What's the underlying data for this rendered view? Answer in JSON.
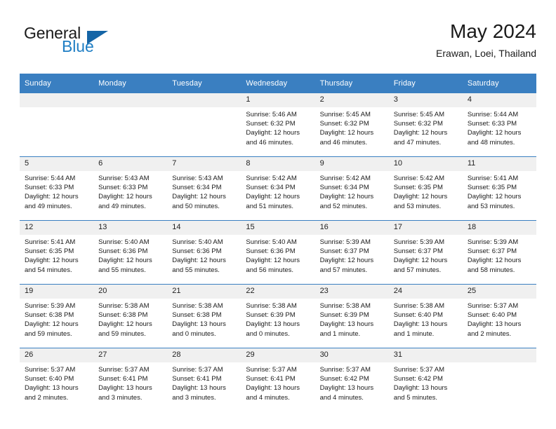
{
  "brand": {
    "name_top": "General",
    "name_bottom": "Blue",
    "triangle_icon": "brand-triangle-icon",
    "accent_color": "#1f7ec4",
    "triangle_color": "#1565a6"
  },
  "header": {
    "title": "May 2024",
    "subtitle": "Erawan, Loei, Thailand"
  },
  "calendar": {
    "header_bg_color": "#3a7fc1",
    "daynum_bg_color": "#f0f0f0",
    "weekday_headers": [
      "Sunday",
      "Monday",
      "Tuesday",
      "Wednesday",
      "Thursday",
      "Friday",
      "Saturday"
    ],
    "weeks": [
      [
        {
          "day": "",
          "empty": true,
          "sunrise": "",
          "sunset": "",
          "daylight_line1": "",
          "daylight_line2": ""
        },
        {
          "day": "",
          "empty": true,
          "sunrise": "",
          "sunset": "",
          "daylight_line1": "",
          "daylight_line2": ""
        },
        {
          "day": "",
          "empty": true,
          "sunrise": "",
          "sunset": "",
          "daylight_line1": "",
          "daylight_line2": ""
        },
        {
          "day": "1",
          "empty": false,
          "sunrise": "Sunrise: 5:46 AM",
          "sunset": "Sunset: 6:32 PM",
          "daylight_line1": "Daylight: 12 hours",
          "daylight_line2": "and 46 minutes."
        },
        {
          "day": "2",
          "empty": false,
          "sunrise": "Sunrise: 5:45 AM",
          "sunset": "Sunset: 6:32 PM",
          "daylight_line1": "Daylight: 12 hours",
          "daylight_line2": "and 46 minutes."
        },
        {
          "day": "3",
          "empty": false,
          "sunrise": "Sunrise: 5:45 AM",
          "sunset": "Sunset: 6:32 PM",
          "daylight_line1": "Daylight: 12 hours",
          "daylight_line2": "and 47 minutes."
        },
        {
          "day": "4",
          "empty": false,
          "sunrise": "Sunrise: 5:44 AM",
          "sunset": "Sunset: 6:33 PM",
          "daylight_line1": "Daylight: 12 hours",
          "daylight_line2": "and 48 minutes."
        }
      ],
      [
        {
          "day": "5",
          "empty": false,
          "sunrise": "Sunrise: 5:44 AM",
          "sunset": "Sunset: 6:33 PM",
          "daylight_line1": "Daylight: 12 hours",
          "daylight_line2": "and 49 minutes."
        },
        {
          "day": "6",
          "empty": false,
          "sunrise": "Sunrise: 5:43 AM",
          "sunset": "Sunset: 6:33 PM",
          "daylight_line1": "Daylight: 12 hours",
          "daylight_line2": "and 49 minutes."
        },
        {
          "day": "7",
          "empty": false,
          "sunrise": "Sunrise: 5:43 AM",
          "sunset": "Sunset: 6:34 PM",
          "daylight_line1": "Daylight: 12 hours",
          "daylight_line2": "and 50 minutes."
        },
        {
          "day": "8",
          "empty": false,
          "sunrise": "Sunrise: 5:42 AM",
          "sunset": "Sunset: 6:34 PM",
          "daylight_line1": "Daylight: 12 hours",
          "daylight_line2": "and 51 minutes."
        },
        {
          "day": "9",
          "empty": false,
          "sunrise": "Sunrise: 5:42 AM",
          "sunset": "Sunset: 6:34 PM",
          "daylight_line1": "Daylight: 12 hours",
          "daylight_line2": "and 52 minutes."
        },
        {
          "day": "10",
          "empty": false,
          "sunrise": "Sunrise: 5:42 AM",
          "sunset": "Sunset: 6:35 PM",
          "daylight_line1": "Daylight: 12 hours",
          "daylight_line2": "and 53 minutes."
        },
        {
          "day": "11",
          "empty": false,
          "sunrise": "Sunrise: 5:41 AM",
          "sunset": "Sunset: 6:35 PM",
          "daylight_line1": "Daylight: 12 hours",
          "daylight_line2": "and 53 minutes."
        }
      ],
      [
        {
          "day": "12",
          "empty": false,
          "sunrise": "Sunrise: 5:41 AM",
          "sunset": "Sunset: 6:35 PM",
          "daylight_line1": "Daylight: 12 hours",
          "daylight_line2": "and 54 minutes."
        },
        {
          "day": "13",
          "empty": false,
          "sunrise": "Sunrise: 5:40 AM",
          "sunset": "Sunset: 6:36 PM",
          "daylight_line1": "Daylight: 12 hours",
          "daylight_line2": "and 55 minutes."
        },
        {
          "day": "14",
          "empty": false,
          "sunrise": "Sunrise: 5:40 AM",
          "sunset": "Sunset: 6:36 PM",
          "daylight_line1": "Daylight: 12 hours",
          "daylight_line2": "and 55 minutes."
        },
        {
          "day": "15",
          "empty": false,
          "sunrise": "Sunrise: 5:40 AM",
          "sunset": "Sunset: 6:36 PM",
          "daylight_line1": "Daylight: 12 hours",
          "daylight_line2": "and 56 minutes."
        },
        {
          "day": "16",
          "empty": false,
          "sunrise": "Sunrise: 5:39 AM",
          "sunset": "Sunset: 6:37 PM",
          "daylight_line1": "Daylight: 12 hours",
          "daylight_line2": "and 57 minutes."
        },
        {
          "day": "17",
          "empty": false,
          "sunrise": "Sunrise: 5:39 AM",
          "sunset": "Sunset: 6:37 PM",
          "daylight_line1": "Daylight: 12 hours",
          "daylight_line2": "and 57 minutes."
        },
        {
          "day": "18",
          "empty": false,
          "sunrise": "Sunrise: 5:39 AM",
          "sunset": "Sunset: 6:37 PM",
          "daylight_line1": "Daylight: 12 hours",
          "daylight_line2": "and 58 minutes."
        }
      ],
      [
        {
          "day": "19",
          "empty": false,
          "sunrise": "Sunrise: 5:39 AM",
          "sunset": "Sunset: 6:38 PM",
          "daylight_line1": "Daylight: 12 hours",
          "daylight_line2": "and 59 minutes."
        },
        {
          "day": "20",
          "empty": false,
          "sunrise": "Sunrise: 5:38 AM",
          "sunset": "Sunset: 6:38 PM",
          "daylight_line1": "Daylight: 12 hours",
          "daylight_line2": "and 59 minutes."
        },
        {
          "day": "21",
          "empty": false,
          "sunrise": "Sunrise: 5:38 AM",
          "sunset": "Sunset: 6:38 PM",
          "daylight_line1": "Daylight: 13 hours",
          "daylight_line2": "and 0 minutes."
        },
        {
          "day": "22",
          "empty": false,
          "sunrise": "Sunrise: 5:38 AM",
          "sunset": "Sunset: 6:39 PM",
          "daylight_line1": "Daylight: 13 hours",
          "daylight_line2": "and 0 minutes."
        },
        {
          "day": "23",
          "empty": false,
          "sunrise": "Sunrise: 5:38 AM",
          "sunset": "Sunset: 6:39 PM",
          "daylight_line1": "Daylight: 13 hours",
          "daylight_line2": "and 1 minute."
        },
        {
          "day": "24",
          "empty": false,
          "sunrise": "Sunrise: 5:38 AM",
          "sunset": "Sunset: 6:40 PM",
          "daylight_line1": "Daylight: 13 hours",
          "daylight_line2": "and 1 minute."
        },
        {
          "day": "25",
          "empty": false,
          "sunrise": "Sunrise: 5:37 AM",
          "sunset": "Sunset: 6:40 PM",
          "daylight_line1": "Daylight: 13 hours",
          "daylight_line2": "and 2 minutes."
        }
      ],
      [
        {
          "day": "26",
          "empty": false,
          "sunrise": "Sunrise: 5:37 AM",
          "sunset": "Sunset: 6:40 PM",
          "daylight_line1": "Daylight: 13 hours",
          "daylight_line2": "and 2 minutes."
        },
        {
          "day": "27",
          "empty": false,
          "sunrise": "Sunrise: 5:37 AM",
          "sunset": "Sunset: 6:41 PM",
          "daylight_line1": "Daylight: 13 hours",
          "daylight_line2": "and 3 minutes."
        },
        {
          "day": "28",
          "empty": false,
          "sunrise": "Sunrise: 5:37 AM",
          "sunset": "Sunset: 6:41 PM",
          "daylight_line1": "Daylight: 13 hours",
          "daylight_line2": "and 3 minutes."
        },
        {
          "day": "29",
          "empty": false,
          "sunrise": "Sunrise: 5:37 AM",
          "sunset": "Sunset: 6:41 PM",
          "daylight_line1": "Daylight: 13 hours",
          "daylight_line2": "and 4 minutes."
        },
        {
          "day": "30",
          "empty": false,
          "sunrise": "Sunrise: 5:37 AM",
          "sunset": "Sunset: 6:42 PM",
          "daylight_line1": "Daylight: 13 hours",
          "daylight_line2": "and 4 minutes."
        },
        {
          "day": "31",
          "empty": false,
          "sunrise": "Sunrise: 5:37 AM",
          "sunset": "Sunset: 6:42 PM",
          "daylight_line1": "Daylight: 13 hours",
          "daylight_line2": "and 5 minutes."
        },
        {
          "day": "",
          "empty": true,
          "sunrise": "",
          "sunset": "",
          "daylight_line1": "",
          "daylight_line2": ""
        }
      ]
    ]
  }
}
